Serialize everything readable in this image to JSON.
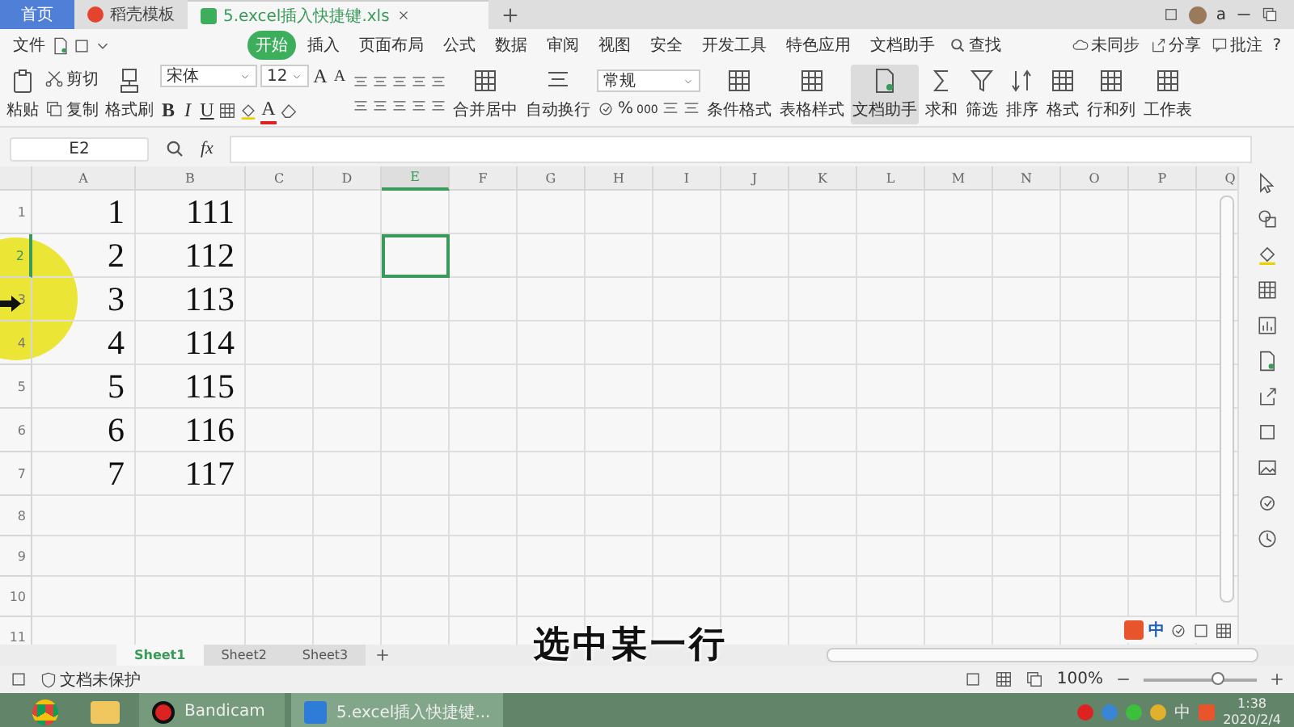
{
  "browser_tabs": [
    {
      "label": "首页",
      "kind": "home",
      "selected": false
    },
    {
      "label": "稻壳模板",
      "kind": "docer",
      "selected": false
    },
    {
      "label": "5.excel插入快捷键.xls",
      "kind": "sheet",
      "selected": true
    }
  ],
  "account": {
    "name": "a"
  },
  "menu": {
    "file": "文件",
    "tabs": [
      {
        "label": "开始",
        "selected": true
      },
      {
        "label": "插入",
        "selected": false
      },
      {
        "label": "页面布局",
        "selected": false
      },
      {
        "label": "公式",
        "selected": false
      },
      {
        "label": "数据",
        "selected": false
      },
      {
        "label": "审阅",
        "selected": false
      },
      {
        "label": "视图",
        "selected": false
      },
      {
        "label": "安全",
        "selected": false
      },
      {
        "label": "开发工具",
        "selected": false
      },
      {
        "label": "特色应用",
        "selected": false
      },
      {
        "label": "文档助手",
        "selected": false
      }
    ],
    "search": "查找",
    "sync": "未同步",
    "share": "分享",
    "comment": "批注",
    "help": "?"
  },
  "ribbon": {
    "paste": "粘贴",
    "cut": "剪切",
    "copy": "复制",
    "format_painter": "格式刷",
    "font": "宋体",
    "font_size": "12",
    "font_grow": "A",
    "font_shrink": "A",
    "bold": "B",
    "italic": "I",
    "underline": "U",
    "font_color": "A",
    "merge": "合并居中",
    "wrap": "自动换行",
    "number_format": "常规",
    "percent": "%",
    "thousands": "000",
    "conditional": "条件格式",
    "table_style": "表格样式",
    "assistant": "文档助手",
    "sum": "求和",
    "filter": "筛选",
    "sort": "排序",
    "format": "格式",
    "rows_columns": "行和列",
    "worksheet": "工作表"
  },
  "formula_bar": {
    "name_box": "E2",
    "fx": "fx"
  },
  "grid": {
    "columns": [
      {
        "label": "A",
        "selected": false
      },
      {
        "label": "B",
        "selected": false
      },
      {
        "label": "C",
        "selected": false
      },
      {
        "label": "D",
        "selected": false
      },
      {
        "label": "E",
        "selected": true
      },
      {
        "label": "F",
        "selected": false
      },
      {
        "label": "G",
        "selected": false
      },
      {
        "label": "H",
        "selected": false
      },
      {
        "label": "I",
        "selected": false
      },
      {
        "label": "J",
        "selected": false
      },
      {
        "label": "K",
        "selected": false
      },
      {
        "label": "L",
        "selected": false
      },
      {
        "label": "M",
        "selected": false
      },
      {
        "label": "N",
        "selected": false
      },
      {
        "label": "O",
        "selected": false
      },
      {
        "label": "P",
        "selected": false
      },
      {
        "label": "Q",
        "selected": false
      }
    ],
    "rows": [
      {
        "label": "1",
        "selected": false,
        "cells": [
          "1",
          "111"
        ]
      },
      {
        "label": "2",
        "selected": true,
        "cells": [
          "2",
          "112"
        ]
      },
      {
        "label": "3",
        "selected": false,
        "cells": [
          "3",
          "113"
        ]
      },
      {
        "label": "4",
        "selected": false,
        "cells": [
          "4",
          "114"
        ]
      },
      {
        "label": "5",
        "selected": false,
        "cells": [
          "5",
          "115"
        ]
      },
      {
        "label": "6",
        "selected": false,
        "cells": [
          "6",
          "116"
        ]
      },
      {
        "label": "7",
        "selected": false,
        "cells": [
          "7",
          "117"
        ]
      },
      {
        "label": "8",
        "selected": false,
        "cells": []
      },
      {
        "label": "9",
        "selected": false,
        "cells": []
      },
      {
        "label": "10",
        "selected": false,
        "cells": []
      },
      {
        "label": "11",
        "selected": false,
        "cells": []
      }
    ]
  },
  "caption": "选中某一行",
  "ime": {
    "mode": "中"
  },
  "sheets": [
    {
      "label": "Sheet1",
      "selected": true
    },
    {
      "label": "Sheet2",
      "selected": false
    },
    {
      "label": "Sheet3",
      "selected": false
    }
  ],
  "status": {
    "protection": "文档未保护",
    "zoom": "100%",
    "zoom_slider": {
      "level": 0.65
    }
  },
  "taskbar": {
    "apps": [
      {
        "kind": "browser"
      },
      {
        "kind": "folder"
      },
      {
        "kind": "recorder",
        "label": "Bandicam"
      },
      {
        "kind": "spreadsheet",
        "label": "5.excel插入快捷键..."
      }
    ],
    "ime": "中",
    "time": "1:38",
    "date": "2020/2/4"
  }
}
